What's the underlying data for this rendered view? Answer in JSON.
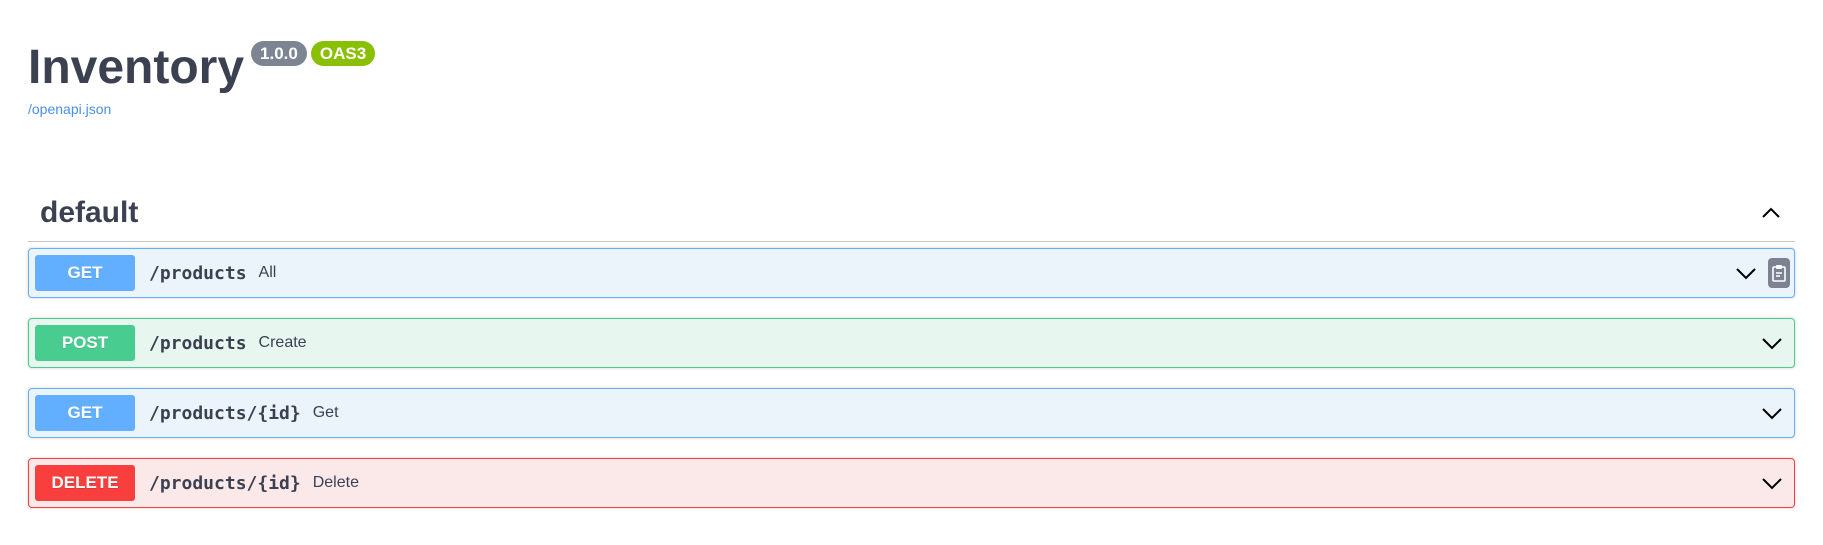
{
  "info": {
    "title": "Inventory",
    "version": "1.0.0",
    "oas_badge": "OAS3",
    "spec_url": "/openapi.json"
  },
  "section": {
    "title": "default",
    "expanded": true
  },
  "operations": [
    {
      "method": "GET",
      "path": "/products",
      "summary": "All",
      "style": "get",
      "show_copy": true
    },
    {
      "method": "POST",
      "path": "/products",
      "summary": "Create",
      "style": "post",
      "show_copy": false
    },
    {
      "method": "GET",
      "path": "/products/{id}",
      "summary": "Get",
      "style": "get",
      "show_copy": false
    },
    {
      "method": "DELETE",
      "path": "/products/{id}",
      "summary": "Delete",
      "style": "delete",
      "show_copy": false
    }
  ],
  "colors": {
    "get": "#61affe",
    "post": "#49cc90",
    "delete": "#f93e3e",
    "text": "#3b4151",
    "link": "#4990e2",
    "version_badge": "#7d8492",
    "oas_badge": "#89bf04"
  },
  "icons": {
    "section_toggle": "chevron-up-icon",
    "op_toggle": "chevron-down-icon",
    "copy": "clipboard-icon"
  }
}
